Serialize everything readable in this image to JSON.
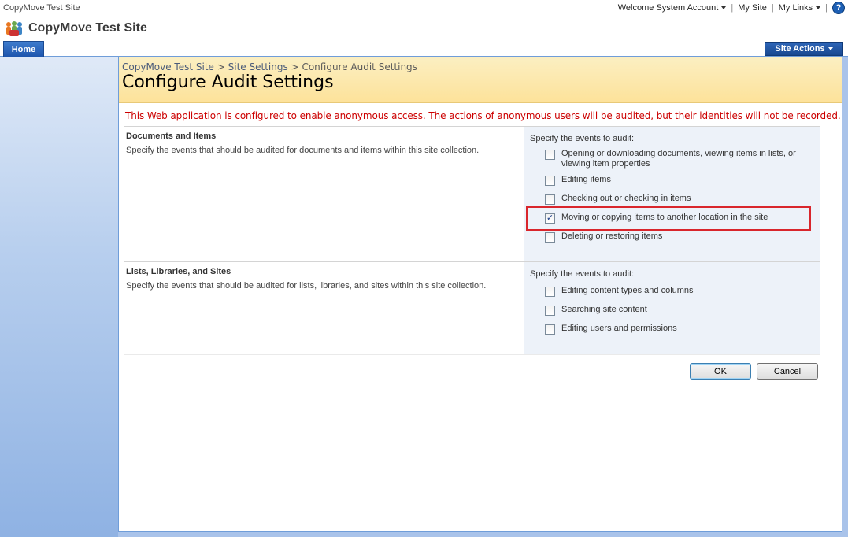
{
  "global": {
    "site_name": "CopyMove Test Site",
    "welcome": "Welcome System Account",
    "my_site": "My Site",
    "my_links": "My Links",
    "separator": "|",
    "help_glyph": "?"
  },
  "header": {
    "title": "CopyMove Test Site",
    "logo_icon": "sharepoint-people-icon"
  },
  "nav": {
    "home_tab": "Home",
    "site_actions": "Site Actions"
  },
  "page": {
    "breadcrumb": [
      "CopyMove Test Site",
      "Site Settings",
      "Configure Audit Settings"
    ],
    "breadcrumb_sep": ">",
    "title": "Configure Audit Settings",
    "warning": "This Web application is configured to enable anonymous access. The actions of anonymous users will be audited, but their identities will not be recorded.",
    "warning_color": "#cc0000"
  },
  "sections": [
    {
      "heading": "Documents and Items",
      "description": "Specify the events that should be audited for documents and items within this site collection.",
      "spec_label": "Specify the events to audit:",
      "options": [
        {
          "label_line1": "Opening or downloading documents, viewing items in lists, or",
          "label_line2": "viewing item properties",
          "checked": false
        },
        {
          "label_line1": "Editing items",
          "checked": false
        },
        {
          "label_line1": "Checking out or checking in items",
          "checked": false
        },
        {
          "label_line1": "Moving or copying items to another location in the site",
          "checked": true,
          "highlighted": true
        },
        {
          "label_line1": "Deleting or restoring items",
          "checked": false
        }
      ]
    },
    {
      "heading": "Lists, Libraries, and Sites",
      "description": "Specify the events that should be audited for lists, libraries, and sites within this site collection.",
      "spec_label": "Specify the events to audit:",
      "options": [
        {
          "label_line1": "Editing content types and columns",
          "checked": false
        },
        {
          "label_line1": "Searching site content",
          "checked": false
        },
        {
          "label_line1": "Editing users and permissions",
          "checked": false
        }
      ]
    }
  ],
  "buttons": {
    "ok": "OK",
    "cancel": "Cancel"
  },
  "colors": {
    "accent_blue": "#1d55ad",
    "header_band": "#fde29a",
    "highlight_red": "#d9262c"
  }
}
